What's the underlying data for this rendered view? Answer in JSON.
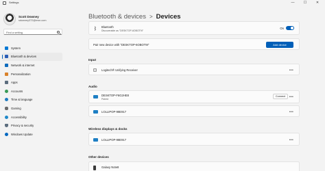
{
  "window": {
    "title": "Settings",
    "controls": {
      "minimize": "—",
      "maximize": "☐",
      "close": "✕"
    }
  },
  "profile": {
    "name": "Scott Downey",
    "email": "sdowney372@msn.com"
  },
  "search": {
    "placeholder": "Find a setting"
  },
  "sidebar": {
    "items": [
      {
        "label": "System",
        "icon": "monitor-icon",
        "color": "#0078d4",
        "active": false
      },
      {
        "label": "Bluetooth & devices",
        "icon": "bluetooth-devices-icon",
        "color": "#2b5db5",
        "active": true
      },
      {
        "label": "Network & internet",
        "icon": "wifi-icon",
        "color": "#0f6cbd",
        "active": false
      },
      {
        "label": "Personalization",
        "icon": "brush-icon",
        "color": "#d9822b",
        "active": false
      },
      {
        "label": "Apps",
        "icon": "apps-icon",
        "color": "#5c6d7e",
        "active": false
      },
      {
        "label": "Accounts",
        "icon": "person-icon",
        "color": "#3a9a57",
        "active": false
      },
      {
        "label": "Time & language",
        "icon": "globe-clock-icon",
        "color": "#1f7bc1",
        "active": false
      },
      {
        "label": "Gaming",
        "icon": "controller-icon",
        "color": "#6b6b6b",
        "active": false
      },
      {
        "label": "Accessibility",
        "icon": "accessibility-icon",
        "color": "#1e88c9",
        "active": false
      },
      {
        "label": "Privacy & security",
        "icon": "shield-icon",
        "color": "#5c6d7e",
        "active": false
      },
      {
        "label": "Windows Update",
        "icon": "refresh-icon",
        "color": "#0067c0",
        "active": false
      }
    ]
  },
  "breadcrumb": {
    "parent": "Bluetooth & devices",
    "separator": ">",
    "current": "Devices"
  },
  "bluetooth": {
    "title": "Bluetooth",
    "subtitle": "Discoverable as \"DESKTOP-6OBOT9I\"",
    "state": "On"
  },
  "pair": {
    "text": "Pair new device with \"DESKTOP-6OBOT9I\"",
    "button": "Add device"
  },
  "sections": {
    "input": {
      "title": "Input",
      "devices": [
        {
          "name": "Logitech® Unifying Receiver",
          "icon": "usb-receiver-icon"
        }
      ]
    },
    "audio": {
      "title": "Audio",
      "devices": [
        {
          "name": "DESKTOP-F6G2HE8",
          "status": "Paired",
          "icon": "monitor-icon",
          "action": "Connect"
        },
        {
          "name": "LOLLIPOP-98E917",
          "icon": "monitor-icon"
        }
      ]
    },
    "wireless": {
      "title": "Wireless displays & docks",
      "devices": [
        {
          "name": "LOLLIPOP-98E917",
          "icon": "monitor-icon"
        }
      ]
    },
    "other": {
      "title": "Other devices",
      "devices": [
        {
          "name": "Galaxy Note8",
          "icon": "phone-icon"
        }
      ]
    }
  },
  "more_label": "•••",
  "colors": {
    "accent": "#005fb8",
    "background": "#f3f3f3",
    "card": "#fbfbfb"
  }
}
